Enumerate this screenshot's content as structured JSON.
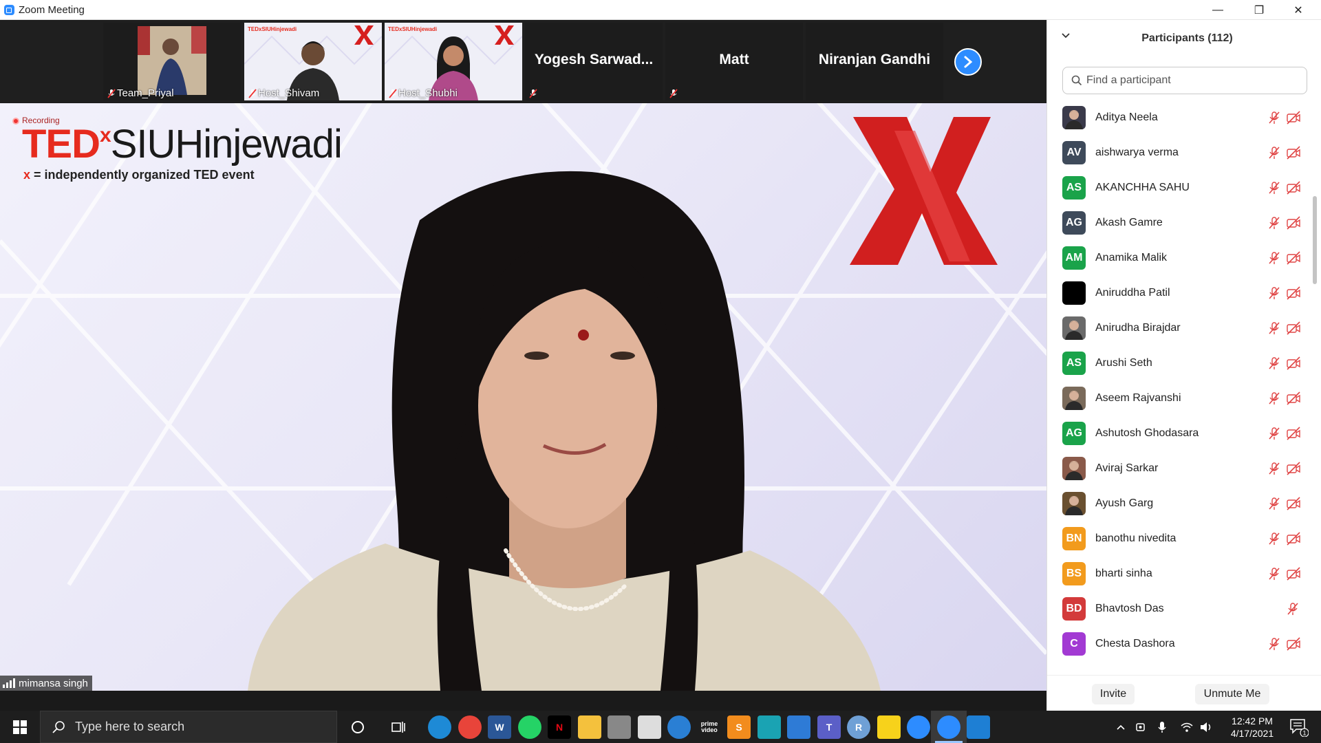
{
  "window": {
    "title": "Zoom Meeting",
    "controls": {
      "minimize": "—",
      "maximize": "❐",
      "close": "✕"
    }
  },
  "thumbnails": [
    {
      "name": "Team_Priyal",
      "type": "video",
      "muted": true
    },
    {
      "name": "Host_Shivam",
      "type": "video",
      "muted": true
    },
    {
      "name": "Host_Shubhi",
      "type": "video",
      "muted": true
    },
    {
      "name": "Yogesh  Sarwad...",
      "type": "text",
      "muted": true
    },
    {
      "name": "Matt",
      "type": "text",
      "muted": true
    },
    {
      "name": "Niranjan Gandhi",
      "type": "text",
      "muted": false
    }
  ],
  "next_button_icon": "chevron-right-icon",
  "main_video": {
    "recording_label": "Recording",
    "logo": {
      "ted": "TED",
      "x": "x",
      "location": "SIUHinjewadi"
    },
    "tagline": {
      "x": "x",
      "text": " = independently organized TED event"
    },
    "speaker_name": "mimansa singh"
  },
  "participants_panel": {
    "title": "Participants (112)",
    "search_placeholder": "Find a participant",
    "participants": [
      {
        "name": "Aditya Neela",
        "initials": "",
        "color": "#3a3a4a",
        "photo": true,
        "mic_muted": true,
        "cam_off": true
      },
      {
        "name": "aishwarya verma",
        "initials": "AV",
        "color": "#3e4a5a",
        "photo": false,
        "mic_muted": true,
        "cam_off": true
      },
      {
        "name": "AKANCHHA SAHU",
        "initials": "AS",
        "color": "#1aa34a",
        "photo": false,
        "mic_muted": true,
        "cam_off": true
      },
      {
        "name": "Akash Gamre",
        "initials": "AG",
        "color": "#3e4a5a",
        "photo": false,
        "mic_muted": true,
        "cam_off": true
      },
      {
        "name": "Anamika Malik",
        "initials": "AM",
        "color": "#1aa34a",
        "photo": false,
        "mic_muted": true,
        "cam_off": true
      },
      {
        "name": "Aniruddha Patil",
        "initials": "",
        "color": "#000000",
        "photo": false,
        "mic_muted": true,
        "cam_off": true
      },
      {
        "name": "Anirudha Birajdar",
        "initials": "",
        "color": "#6a6a6a",
        "photo": true,
        "mic_muted": true,
        "cam_off": true
      },
      {
        "name": "Arushi Seth",
        "initials": "AS",
        "color": "#1aa34a",
        "photo": false,
        "mic_muted": true,
        "cam_off": true
      },
      {
        "name": "Aseem Rajvanshi",
        "initials": "",
        "color": "#7a6a5a",
        "photo": true,
        "mic_muted": true,
        "cam_off": true
      },
      {
        "name": "Ashutosh Ghodasara",
        "initials": "AG",
        "color": "#1aa34a",
        "photo": false,
        "mic_muted": true,
        "cam_off": true
      },
      {
        "name": "Aviraj Sarkar",
        "initials": "",
        "color": "#8a5a4a",
        "photo": true,
        "mic_muted": true,
        "cam_off": true
      },
      {
        "name": "Ayush Garg",
        "initials": "",
        "color": "#6a5030",
        "photo": true,
        "mic_muted": true,
        "cam_off": true
      },
      {
        "name": "banothu nivedita",
        "initials": "BN",
        "color": "#f29b1d",
        "photo": false,
        "mic_muted": true,
        "cam_off": true
      },
      {
        "name": "bharti sinha",
        "initials": "BS",
        "color": "#f29b1d",
        "photo": false,
        "mic_muted": true,
        "cam_off": true
      },
      {
        "name": "Bhavtosh Das",
        "initials": "BD",
        "color": "#d33a3a",
        "photo": false,
        "mic_muted": true,
        "cam_off": false
      },
      {
        "name": "Chesta Dashora",
        "initials": "C",
        "color": "#a23ad3",
        "photo": false,
        "mic_muted": true,
        "cam_off": true
      }
    ],
    "invite_label": "Invite",
    "unmute_label": "Unmute Me"
  },
  "taskbar": {
    "search_placeholder": "Type here to search",
    "apps": [
      {
        "name": "edge",
        "label": "",
        "color": "#1e8ad6"
      },
      {
        "name": "chrome",
        "label": "",
        "color": "#e8443a"
      },
      {
        "name": "word",
        "label": "W",
        "color": "#2b5797"
      },
      {
        "name": "whatsapp",
        "label": "",
        "color": "#25d366"
      },
      {
        "name": "netflix",
        "label": "N",
        "color": "#000000"
      },
      {
        "name": "file-explorer",
        "label": "",
        "color": "#f4c13d"
      },
      {
        "name": "onedrive",
        "label": "",
        "color": "#888888"
      },
      {
        "name": "store",
        "label": "",
        "color": "#dddddd"
      },
      {
        "name": "browser",
        "label": "",
        "color": "#2a7fd4"
      },
      {
        "name": "prime-video",
        "label": "prime video",
        "color": "#1e1e1e"
      },
      {
        "name": "sublime",
        "label": "S",
        "color": "#f28c1d"
      },
      {
        "name": "instagram",
        "label": "",
        "color": "#1aa3b3"
      },
      {
        "name": "outlook",
        "label": "",
        "color": "#2e7bd6"
      },
      {
        "name": "teams",
        "label": "T",
        "color": "#5b5fc7"
      },
      {
        "name": "r-studio",
        "label": "R",
        "color": "#6fa0d6"
      },
      {
        "name": "sticky-notes",
        "label": "",
        "color": "#f7d21b"
      },
      {
        "name": "zoom",
        "label": "",
        "color": "#2d8cff"
      },
      {
        "name": "zoom-meeting",
        "label": "",
        "color": "#2d8cff"
      },
      {
        "name": "media-player",
        "label": "",
        "color": "#1e7fd4"
      }
    ],
    "clock_time": "12:42 PM",
    "clock_date": "4/17/2021",
    "notification_count": "1"
  }
}
